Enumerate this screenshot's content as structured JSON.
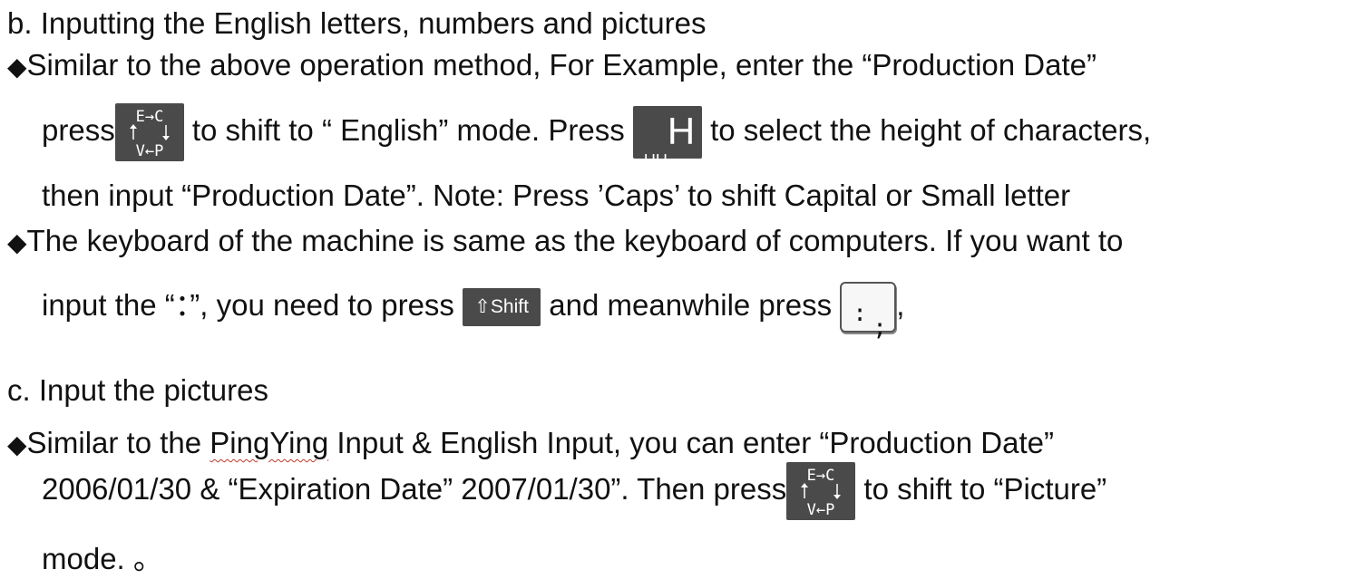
{
  "heading_b": "b. Inputting the English letters, numbers and pictures",
  "bullet_glyph": "◆",
  "p1": {
    "line1": "Similar to the above operation method,  For Example, enter the  “Production  Date”",
    "line2a": "press",
    "line2b": " to shift to “ English” mode. Press ",
    "line2c": " to select the height of characters,",
    "line3": "then input “Production Date”. Note:   Press ’Caps’ to shift Capital or Small letter"
  },
  "p2": {
    "line1": "The keyboard of the machine is same as the keyboard of computers. If you want  to",
    "line2a": "input the “：”, you need to press ",
    "line2b": " and meanwhile press ",
    "line2c": ","
  },
  "heading_c": "c. Input the pictures",
  "p3": {
    "line1a": "Similar to the ",
    "line1b": "PingYing",
    "line1c": " Input & English Input, you can enter “Production Date”",
    "line2a": "2006/01/30 &  “Expiration  Date” 2007/01/30”.  Then  press",
    "line2b": "  to  shift  to “Picture”",
    "line3": "mode.  。"
  },
  "keys": {
    "ec_top": "E→C",
    "ec_bottom": "V←P",
    "hh_small": "HH",
    "hh_big": "H",
    "shift": "⇧Shift",
    "colon_top": ":",
    "colon_bottom": ";"
  }
}
